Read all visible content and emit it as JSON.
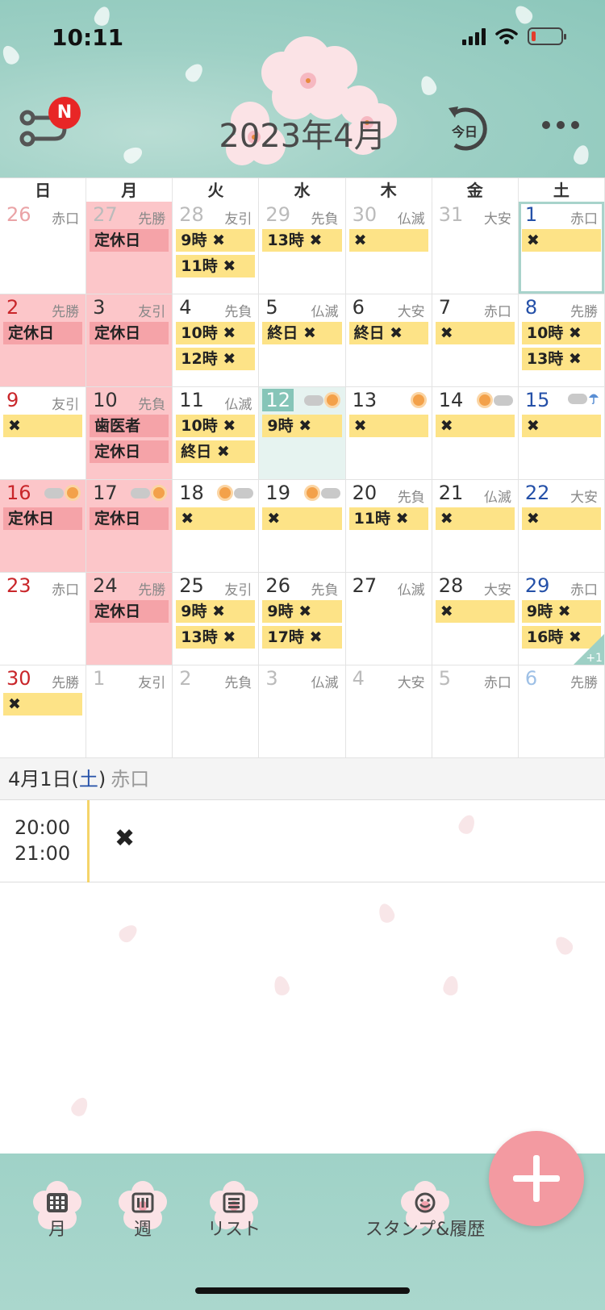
{
  "status_bar": {
    "time": "10:11"
  },
  "header": {
    "title": "2023年4月",
    "today_label": "今日",
    "badge": "N"
  },
  "weekdays": [
    "日",
    "月",
    "火",
    "水",
    "木",
    "金",
    "土"
  ],
  "weeks": [
    [
      {
        "day": "26",
        "rokuyo": "赤口",
        "other": true,
        "events": []
      },
      {
        "day": "27",
        "rokuyo": "先勝",
        "other": true,
        "holiday": true,
        "events": [
          {
            "text": "定休日",
            "color": "red"
          }
        ]
      },
      {
        "day": "28",
        "rokuyo": "友引",
        "other": true,
        "events": [
          {
            "text": "9時 ✖",
            "color": "yellow"
          },
          {
            "text": "11時 ✖",
            "color": "yellow"
          }
        ]
      },
      {
        "day": "29",
        "rokuyo": "先負",
        "other": true,
        "events": [
          {
            "text": "13時 ✖",
            "color": "yellow"
          }
        ]
      },
      {
        "day": "30",
        "rokuyo": "仏滅",
        "other": true,
        "events": [
          {
            "text": "✖",
            "color": "yellow"
          }
        ]
      },
      {
        "day": "31",
        "rokuyo": "大安",
        "other": true,
        "events": []
      },
      {
        "day": "1",
        "rokuyo": "赤口",
        "selected": true,
        "events": [
          {
            "text": "✖",
            "color": "yellow"
          }
        ]
      }
    ],
    [
      {
        "day": "2",
        "rokuyo": "先勝",
        "holiday": true,
        "events": [
          {
            "text": "定休日",
            "color": "red"
          }
        ]
      },
      {
        "day": "3",
        "rokuyo": "友引",
        "holiday": true,
        "events": [
          {
            "text": "定休日",
            "color": "red"
          }
        ]
      },
      {
        "day": "4",
        "rokuyo": "先負",
        "events": [
          {
            "text": "10時 ✖",
            "color": "yellow"
          },
          {
            "text": "12時 ✖",
            "color": "yellow"
          }
        ]
      },
      {
        "day": "5",
        "rokuyo": "仏滅",
        "events": [
          {
            "text": "終日 ✖",
            "color": "yellow"
          }
        ]
      },
      {
        "day": "6",
        "rokuyo": "大安",
        "events": [
          {
            "text": "終日 ✖",
            "color": "yellow"
          }
        ]
      },
      {
        "day": "7",
        "rokuyo": "赤口",
        "events": [
          {
            "text": "✖",
            "color": "yellow"
          }
        ]
      },
      {
        "day": "8",
        "rokuyo": "先勝",
        "events": [
          {
            "text": "10時 ✖",
            "color": "yellow"
          },
          {
            "text": "13時 ✖",
            "color": "yellow"
          }
        ]
      }
    ],
    [
      {
        "day": "9",
        "rokuyo": "友引",
        "events": [
          {
            "text": "✖",
            "color": "yellow"
          }
        ]
      },
      {
        "day": "10",
        "rokuyo": "先負",
        "holiday": true,
        "events": [
          {
            "text": "歯医者",
            "color": "red"
          },
          {
            "text": "定休日",
            "color": "red"
          }
        ]
      },
      {
        "day": "11",
        "rokuyo": "仏滅",
        "events": [
          {
            "text": "10時 ✖",
            "color": "yellow"
          },
          {
            "text": "終日 ✖",
            "color": "yellow"
          }
        ]
      },
      {
        "day": "12",
        "today": true,
        "weather": "cloud-sun",
        "events": [
          {
            "text": "9時 ✖",
            "color": "yellow"
          }
        ]
      },
      {
        "day": "13",
        "weather": "sun",
        "events": [
          {
            "text": "✖",
            "color": "yellow"
          }
        ]
      },
      {
        "day": "14",
        "weather": "sun-cloud",
        "events": [
          {
            "text": "✖",
            "color": "yellow"
          }
        ]
      },
      {
        "day": "15",
        "weather": "cloud-umbrella",
        "events": [
          {
            "text": "✖",
            "color": "yellow"
          }
        ]
      }
    ],
    [
      {
        "day": "16",
        "weather": "cloud-sun",
        "holiday": true,
        "events": [
          {
            "text": "定休日",
            "color": "red"
          }
        ]
      },
      {
        "day": "17",
        "weather": "cloud-sun",
        "holiday": true,
        "events": [
          {
            "text": "定休日",
            "color": "red"
          }
        ]
      },
      {
        "day": "18",
        "weather": "sun-cloud",
        "events": [
          {
            "text": "✖",
            "color": "yellow"
          }
        ]
      },
      {
        "day": "19",
        "weather": "sun-cloud",
        "events": [
          {
            "text": "✖",
            "color": "yellow"
          }
        ]
      },
      {
        "day": "20",
        "rokuyo": "先負",
        "events": [
          {
            "text": "11時 ✖",
            "color": "yellow"
          }
        ]
      },
      {
        "day": "21",
        "rokuyo": "仏滅",
        "events": [
          {
            "text": "✖",
            "color": "yellow"
          }
        ]
      },
      {
        "day": "22",
        "rokuyo": "大安",
        "events": [
          {
            "text": "✖",
            "color": "yellow"
          }
        ]
      }
    ],
    [
      {
        "day": "23",
        "rokuyo": "赤口",
        "events": []
      },
      {
        "day": "24",
        "rokuyo": "先勝",
        "holiday": true,
        "events": [
          {
            "text": "定休日",
            "color": "red"
          }
        ]
      },
      {
        "day": "25",
        "rokuyo": "友引",
        "events": [
          {
            "text": "9時 ✖",
            "color": "yellow"
          },
          {
            "text": "13時 ✖",
            "color": "yellow"
          }
        ]
      },
      {
        "day": "26",
        "rokuyo": "先負",
        "events": [
          {
            "text": "9時 ✖",
            "color": "yellow"
          },
          {
            "text": "17時 ✖",
            "color": "yellow"
          }
        ]
      },
      {
        "day": "27",
        "rokuyo": "仏滅",
        "events": []
      },
      {
        "day": "28",
        "rokuyo": "大安",
        "events": [
          {
            "text": "✖",
            "color": "yellow"
          }
        ]
      },
      {
        "day": "29",
        "rokuyo": "赤口",
        "more": "+1",
        "events": [
          {
            "text": "9時 ✖",
            "color": "yellow"
          },
          {
            "text": "16時 ✖",
            "color": "yellow"
          }
        ]
      }
    ],
    [
      {
        "day": "30",
        "rokuyo": "先勝",
        "events": [
          {
            "text": "✖",
            "color": "yellow"
          }
        ]
      },
      {
        "day": "1",
        "rokuyo": "友引",
        "other": true,
        "events": []
      },
      {
        "day": "2",
        "rokuyo": "先負",
        "other": true,
        "events": []
      },
      {
        "day": "3",
        "rokuyo": "仏滅",
        "other": true,
        "events": []
      },
      {
        "day": "4",
        "rokuyo": "大安",
        "other": true,
        "events": []
      },
      {
        "day": "5",
        "rokuyo": "赤口",
        "other": true,
        "events": []
      },
      {
        "day": "6",
        "rokuyo": "先勝",
        "other": true,
        "events": []
      }
    ]
  ],
  "day_detail": {
    "date_prefix": "4月1日(",
    "weekday": "土",
    "date_suffix": ")",
    "rokuyo": "赤口",
    "event": {
      "start": "20:00",
      "end": "21:00",
      "mark": "✖"
    }
  },
  "tabs": [
    {
      "label": "月",
      "icon": "calendar-grid-icon"
    },
    {
      "label": "週",
      "icon": "calendar-week-icon"
    },
    {
      "label": "リスト",
      "icon": "list-icon"
    },
    {
      "label": "スタンプ&履歴",
      "icon": "smile-icon"
    }
  ],
  "colors": {
    "header_bg": "#9ed0c5",
    "holiday_bg": "#fcc6c9",
    "event_yellow": "#fde387",
    "event_red": "#f5a3a8",
    "fab": "#f39aa1",
    "sunday": "#c9262a",
    "saturday": "#2450a8"
  }
}
